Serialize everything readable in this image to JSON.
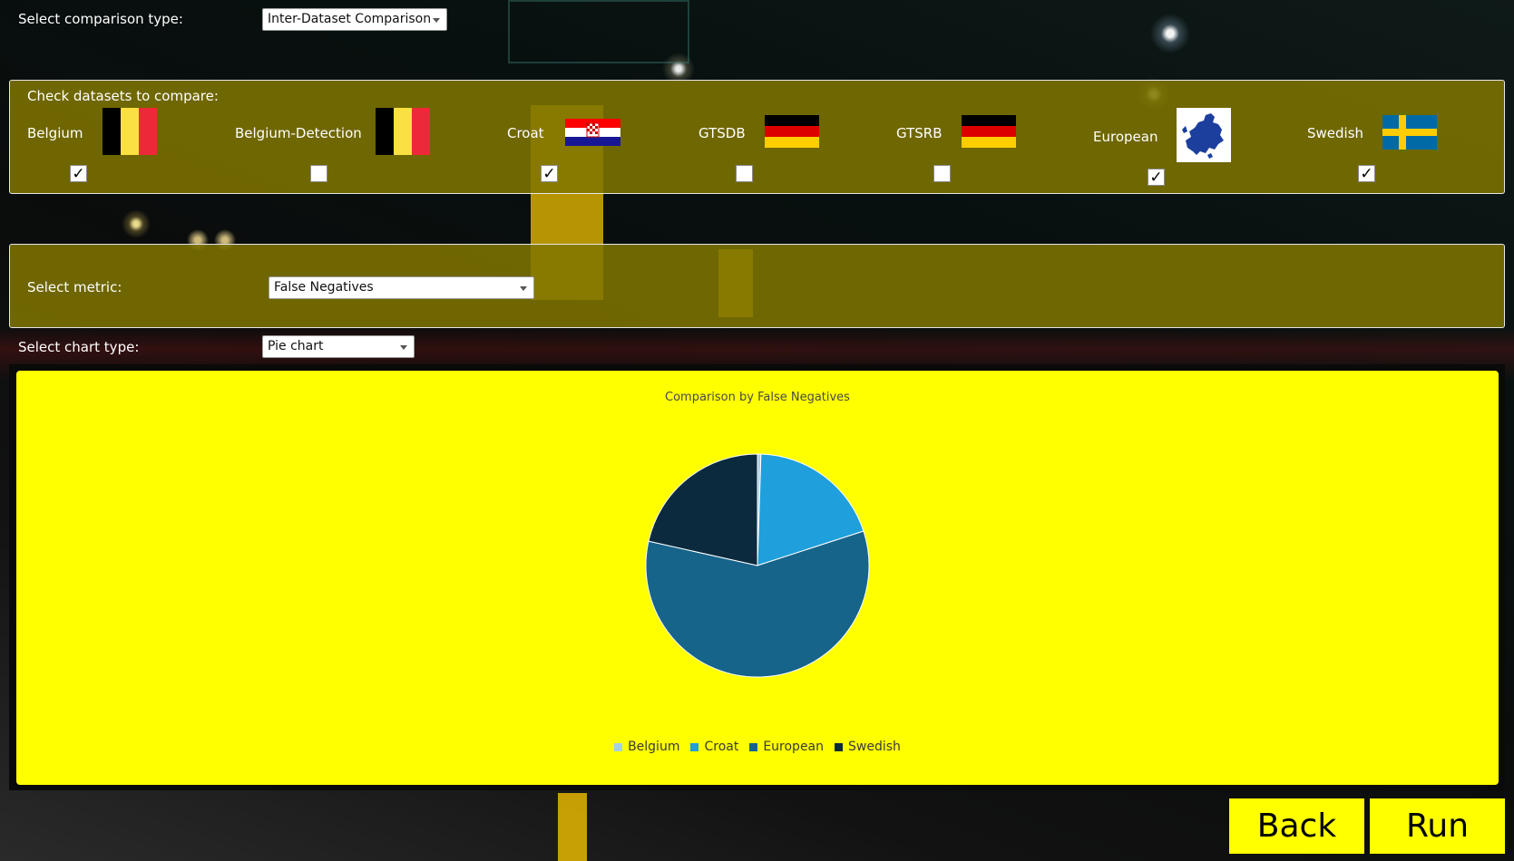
{
  "controls": {
    "comparison_type_label": "Select comparison type:",
    "comparison_type_value": "Inter-Dataset Comparison",
    "datasets_label": "Check datasets to compare:",
    "metric_label": "Select metric:",
    "metric_value": "False Negatives",
    "chart_type_label": "Select chart type:",
    "chart_type_value": "Pie chart"
  },
  "datasets": [
    {
      "name": "Belgium",
      "flag": "belgium-flag",
      "checked": true
    },
    {
      "name": "Belgium-Detection",
      "flag": "belgium-flag",
      "checked": false
    },
    {
      "name": "Croat",
      "flag": "croatia-flag",
      "checked": true
    },
    {
      "name": "GTSDB",
      "flag": "germany-flag",
      "checked": false
    },
    {
      "name": "GTSRB",
      "flag": "germany-flag",
      "checked": false
    },
    {
      "name": "European",
      "flag": "europe-map-icon",
      "checked": true
    },
    {
      "name": "Swedish",
      "flag": "sweden-flag",
      "checked": true
    }
  ],
  "colors": {
    "panel": "#807600",
    "chart_bg": "#ffff00",
    "button_bg": "#ffff00"
  },
  "chart_data": {
    "type": "pie",
    "title": "Comparison by False Negatives",
    "legend_position": "bottom",
    "slices": [
      {
        "label": "Belgium",
        "value": 0.5,
        "color": "#a6cfe8"
      },
      {
        "label": "Croat",
        "value": 19.5,
        "color": "#1f9fdb"
      },
      {
        "label": "European",
        "value": 58.5,
        "color": "#17648a"
      },
      {
        "label": "Swedish",
        "value": 21.5,
        "color": "#0b2a3e"
      }
    ]
  },
  "buttons": {
    "back": "Back",
    "run": "Run"
  }
}
